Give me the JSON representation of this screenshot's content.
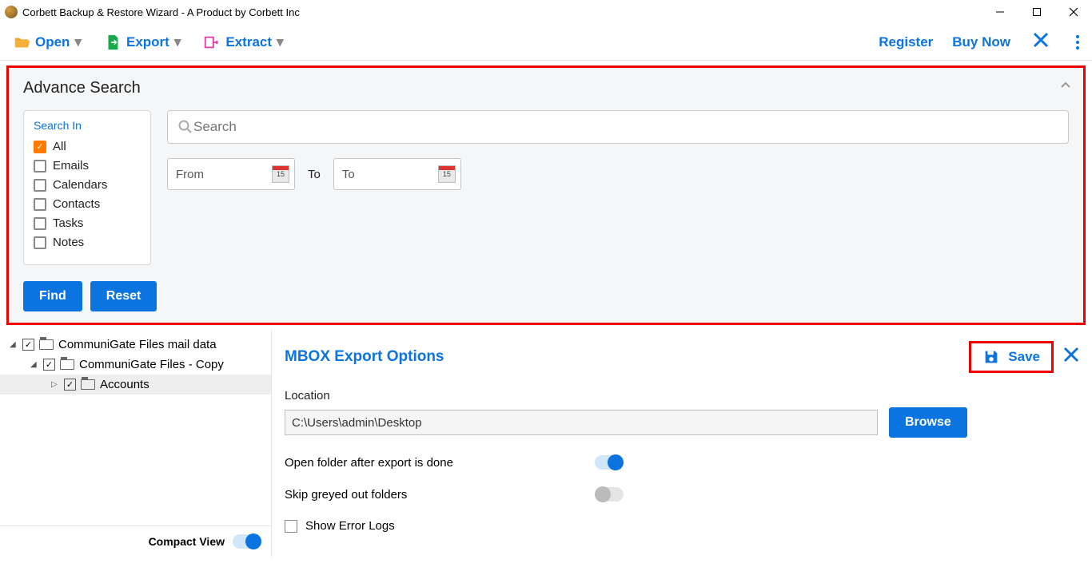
{
  "title": "Corbett Backup & Restore Wizard - A Product by Corbett Inc",
  "toolbar": {
    "open": "Open",
    "export": "Export",
    "extract": "Extract",
    "register": "Register",
    "buynow": "Buy Now"
  },
  "adv": {
    "title": "Advance Search",
    "search_in": "Search In",
    "items": {
      "all": "All",
      "emails": "Emails",
      "calendars": "Calendars",
      "contacts": "Contacts",
      "tasks": "Tasks",
      "notes": "Notes"
    },
    "search_placeholder": "Search",
    "from_placeholder": "From",
    "to_sep": "To",
    "to_placeholder": "To",
    "cal_day": "15",
    "find": "Find",
    "reset": "Reset"
  },
  "tree": {
    "n1": "CommuniGate Files mail data",
    "n2": "CommuniGate Files - Copy",
    "n3": "Accounts"
  },
  "compact": "Compact View",
  "export_panel": {
    "title": "MBOX Export Options",
    "save": "Save",
    "location_label": "Location",
    "location_value": "C:\\Users\\admin\\Desktop",
    "browse": "Browse",
    "open_after": "Open folder after export is done",
    "skip_grey": "Skip greyed out folders",
    "show_err": "Show Error Logs"
  }
}
